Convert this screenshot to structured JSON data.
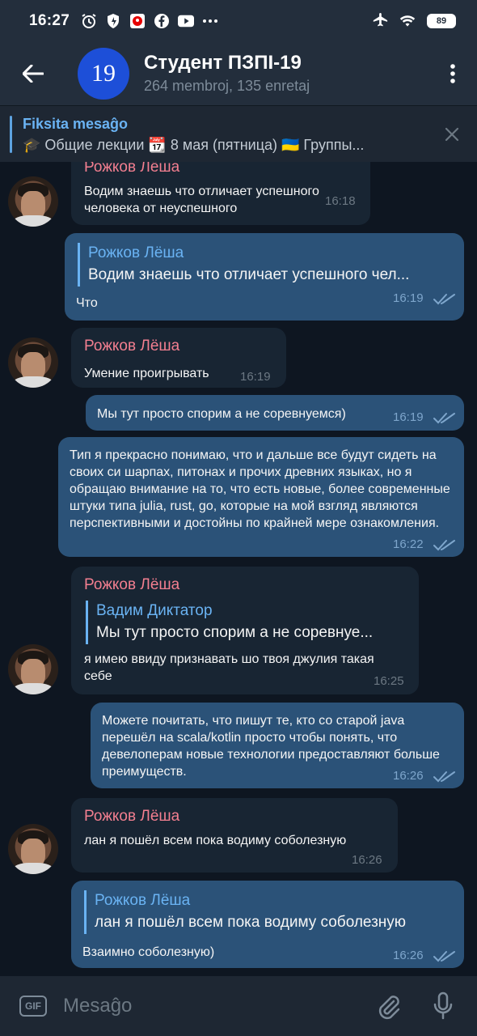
{
  "status_bar": {
    "time": "16:27",
    "battery": "89"
  },
  "header": {
    "avatar_text": "19",
    "title": "Студент ПЗПІ-19",
    "subtitle": "264 membroj, 135 enretaj"
  },
  "pinned": {
    "label": "Fiksita mesaĝo",
    "text": "🎓 Общие лекции 📆 8 мая (пятница)  🇺🇦 Группы..."
  },
  "messages": [
    {
      "direction": "in",
      "sender": "Рожков Лёша",
      "text": "Водим знаешь что отличает успешного человека от неуспешного",
      "time": "16:18"
    },
    {
      "direction": "out",
      "reply": {
        "name": "Рожков Лёша",
        "text": "Водим знаешь что отличает успешного чел..."
      },
      "text": "Что",
      "time": "16:19"
    },
    {
      "direction": "in",
      "sender": "Рожков Лёша",
      "text": "Умение проигрывать",
      "time": "16:19"
    },
    {
      "direction": "out",
      "text": "Мы тут просто спорим а не соревнуемся)",
      "time": "16:19"
    },
    {
      "direction": "out",
      "text": "Тип я прекрасно понимаю, что и дальше все будут сидеть на своих си шарпах, питонах и прочих древних языках, но я обращаю внимание на то, что есть новые, более современные штуки типа julia, rust, go, которые на мой взгляд являются перспективными и достойны по крайней мере ознакомления.",
      "time": "16:22"
    },
    {
      "direction": "in",
      "sender": "Рожков Лёша",
      "reply": {
        "name": "Вадим Диктатор",
        "text": "Мы тут просто спорим а не соревнуе..."
      },
      "text": "я имею ввиду признавать шо твоя джулия такая себе",
      "time": "16:25"
    },
    {
      "direction": "out",
      "text": "Можете почитать, что пишут те, кто со старой java перешёл на scala/kotlin просто чтобы понять, что девелоперам новые технологии предоставляют больше преимуществ.",
      "time": "16:26"
    },
    {
      "direction": "in",
      "sender": "Рожков Лёша",
      "text": "лан я пошёл всем пока водиму соболезную",
      "time": "16:26"
    },
    {
      "direction": "out",
      "reply": {
        "name": "Рожков Лёша",
        "text": "лан я пошёл всем пока водиму соболезную"
      },
      "text": "Взаимно соболезную)",
      "time": "16:26"
    }
  ],
  "input": {
    "gif_label": "GIF",
    "placeholder": "Mesaĝo"
  },
  "colors": {
    "header_bg": "#232e3c",
    "chat_bg": "#0e1621",
    "incoming_bubble": "#182533",
    "outgoing_bubble": "#2b5278",
    "sender_name": "#f37f90",
    "accent": "#6ab3f3"
  }
}
